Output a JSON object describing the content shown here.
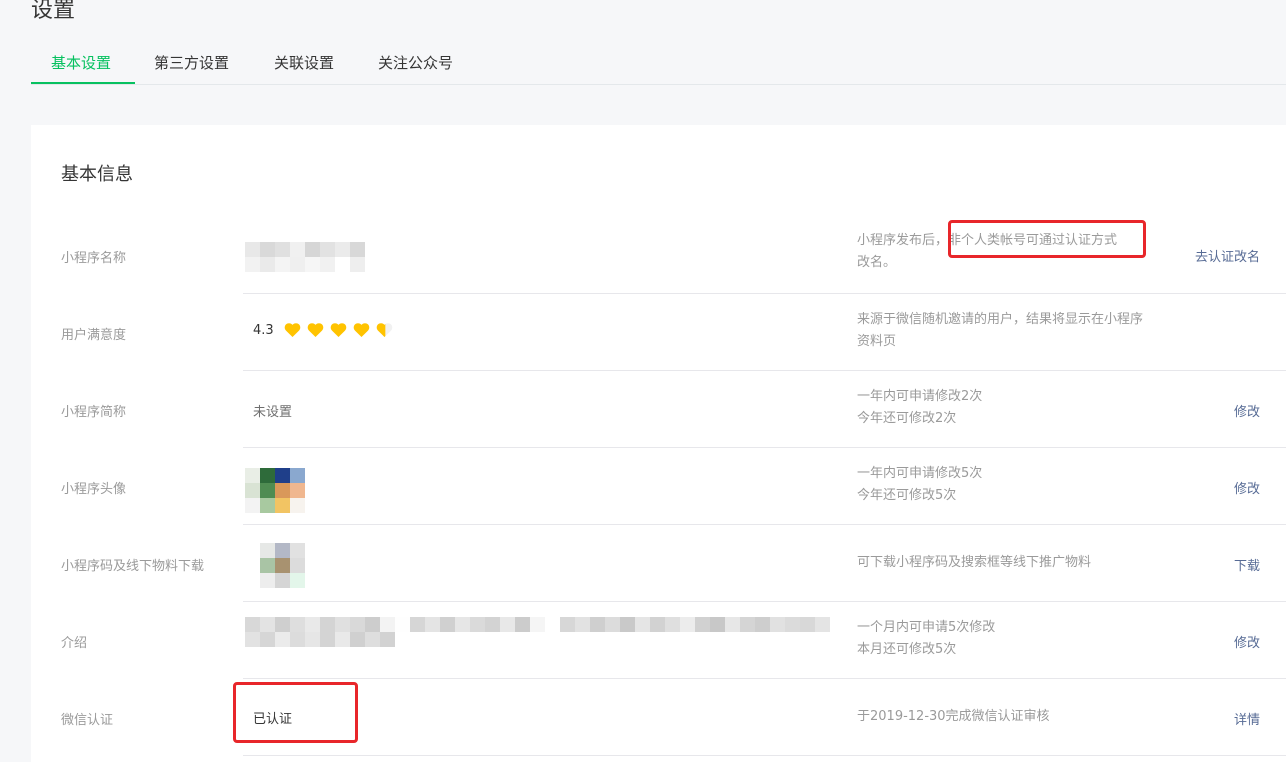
{
  "page": {
    "title": "设置"
  },
  "tabs": [
    {
      "label": "基本设置",
      "active": true
    },
    {
      "label": "第三方设置",
      "active": false
    },
    {
      "label": "关联设置",
      "active": false
    },
    {
      "label": "关注公众号",
      "active": false
    }
  ],
  "card": {
    "title": "基本信息"
  },
  "rows": {
    "name": {
      "label": "小程序名称",
      "desc_part1": "小程序发布后，",
      "desc_highlight": "非个人类帐号可通过认证方式",
      "desc_part2": "改名。",
      "action": "去认证改名"
    },
    "satisfaction": {
      "label": "用户满意度",
      "score": "4.3",
      "stars": 4.3,
      "desc": "来源于微信随机邀请的用户，结果将显示在小程序资料页"
    },
    "short_name": {
      "label": "小程序简称",
      "value": "未设置",
      "desc_line1": "一年内可申请修改2次",
      "desc_line2": "今年还可修改2次",
      "action": "修改"
    },
    "avatar": {
      "label": "小程序头像",
      "desc_line1": "一年内可申请修改5次",
      "desc_line2": "今年还可修改5次",
      "action": "修改"
    },
    "qrcode": {
      "label": "小程序码及线下物料下载",
      "desc": "可下载小程序码及搜索框等线下推广物料",
      "action": "下载"
    },
    "intro": {
      "label": "介绍",
      "desc_line1": "一个月内可申请5次修改",
      "desc_line2": "本月还可修改5次",
      "action": "修改"
    },
    "wechat_cert": {
      "label": "微信认证",
      "value": "已认证",
      "desc": "于2019-12-30完成微信认证审核",
      "action": "详情"
    }
  },
  "colors": {
    "accent": "#07c160",
    "link": "#576b95",
    "highlight_box": "#e8262a",
    "heart": "#ffc300"
  }
}
